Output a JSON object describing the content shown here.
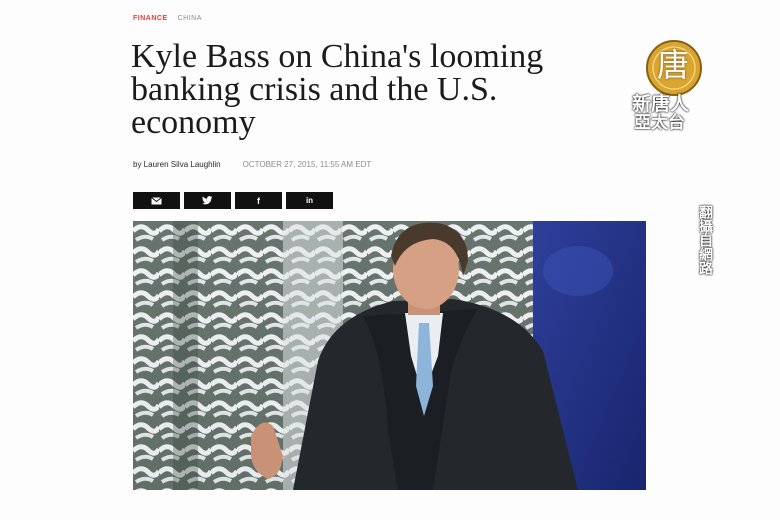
{
  "article": {
    "category": "FINANCE",
    "subcategory": "CHINA",
    "headline": "Kyle Bass on China's looming banking crisis and the U.S. economy",
    "byline": "by Lauren Silva Laughlin",
    "date": "OCTOBER 27, 2015, 11:55 AM EDT"
  },
  "share": {
    "buttons": [
      {
        "name": "email",
        "icon": "email-icon",
        "glyph": "✉"
      },
      {
        "name": "twitter",
        "icon": "twitter-icon",
        "glyph": "🐦"
      },
      {
        "name": "facebook",
        "icon": "facebook-icon",
        "glyph": "f"
      },
      {
        "name": "linkedin",
        "icon": "linkedin-icon",
        "glyph": "in"
      }
    ]
  },
  "photo": {
    "description_icon": "interview-photo"
  },
  "watermark": {
    "logo_char": "唐",
    "station_line1": "新唐人",
    "station_line2": "亞太台",
    "vertical_caption": "翻攝自網路"
  },
  "colors": {
    "category": "#e2423a",
    "share_bg": "#111111",
    "logo_gold": "#d9a531"
  }
}
